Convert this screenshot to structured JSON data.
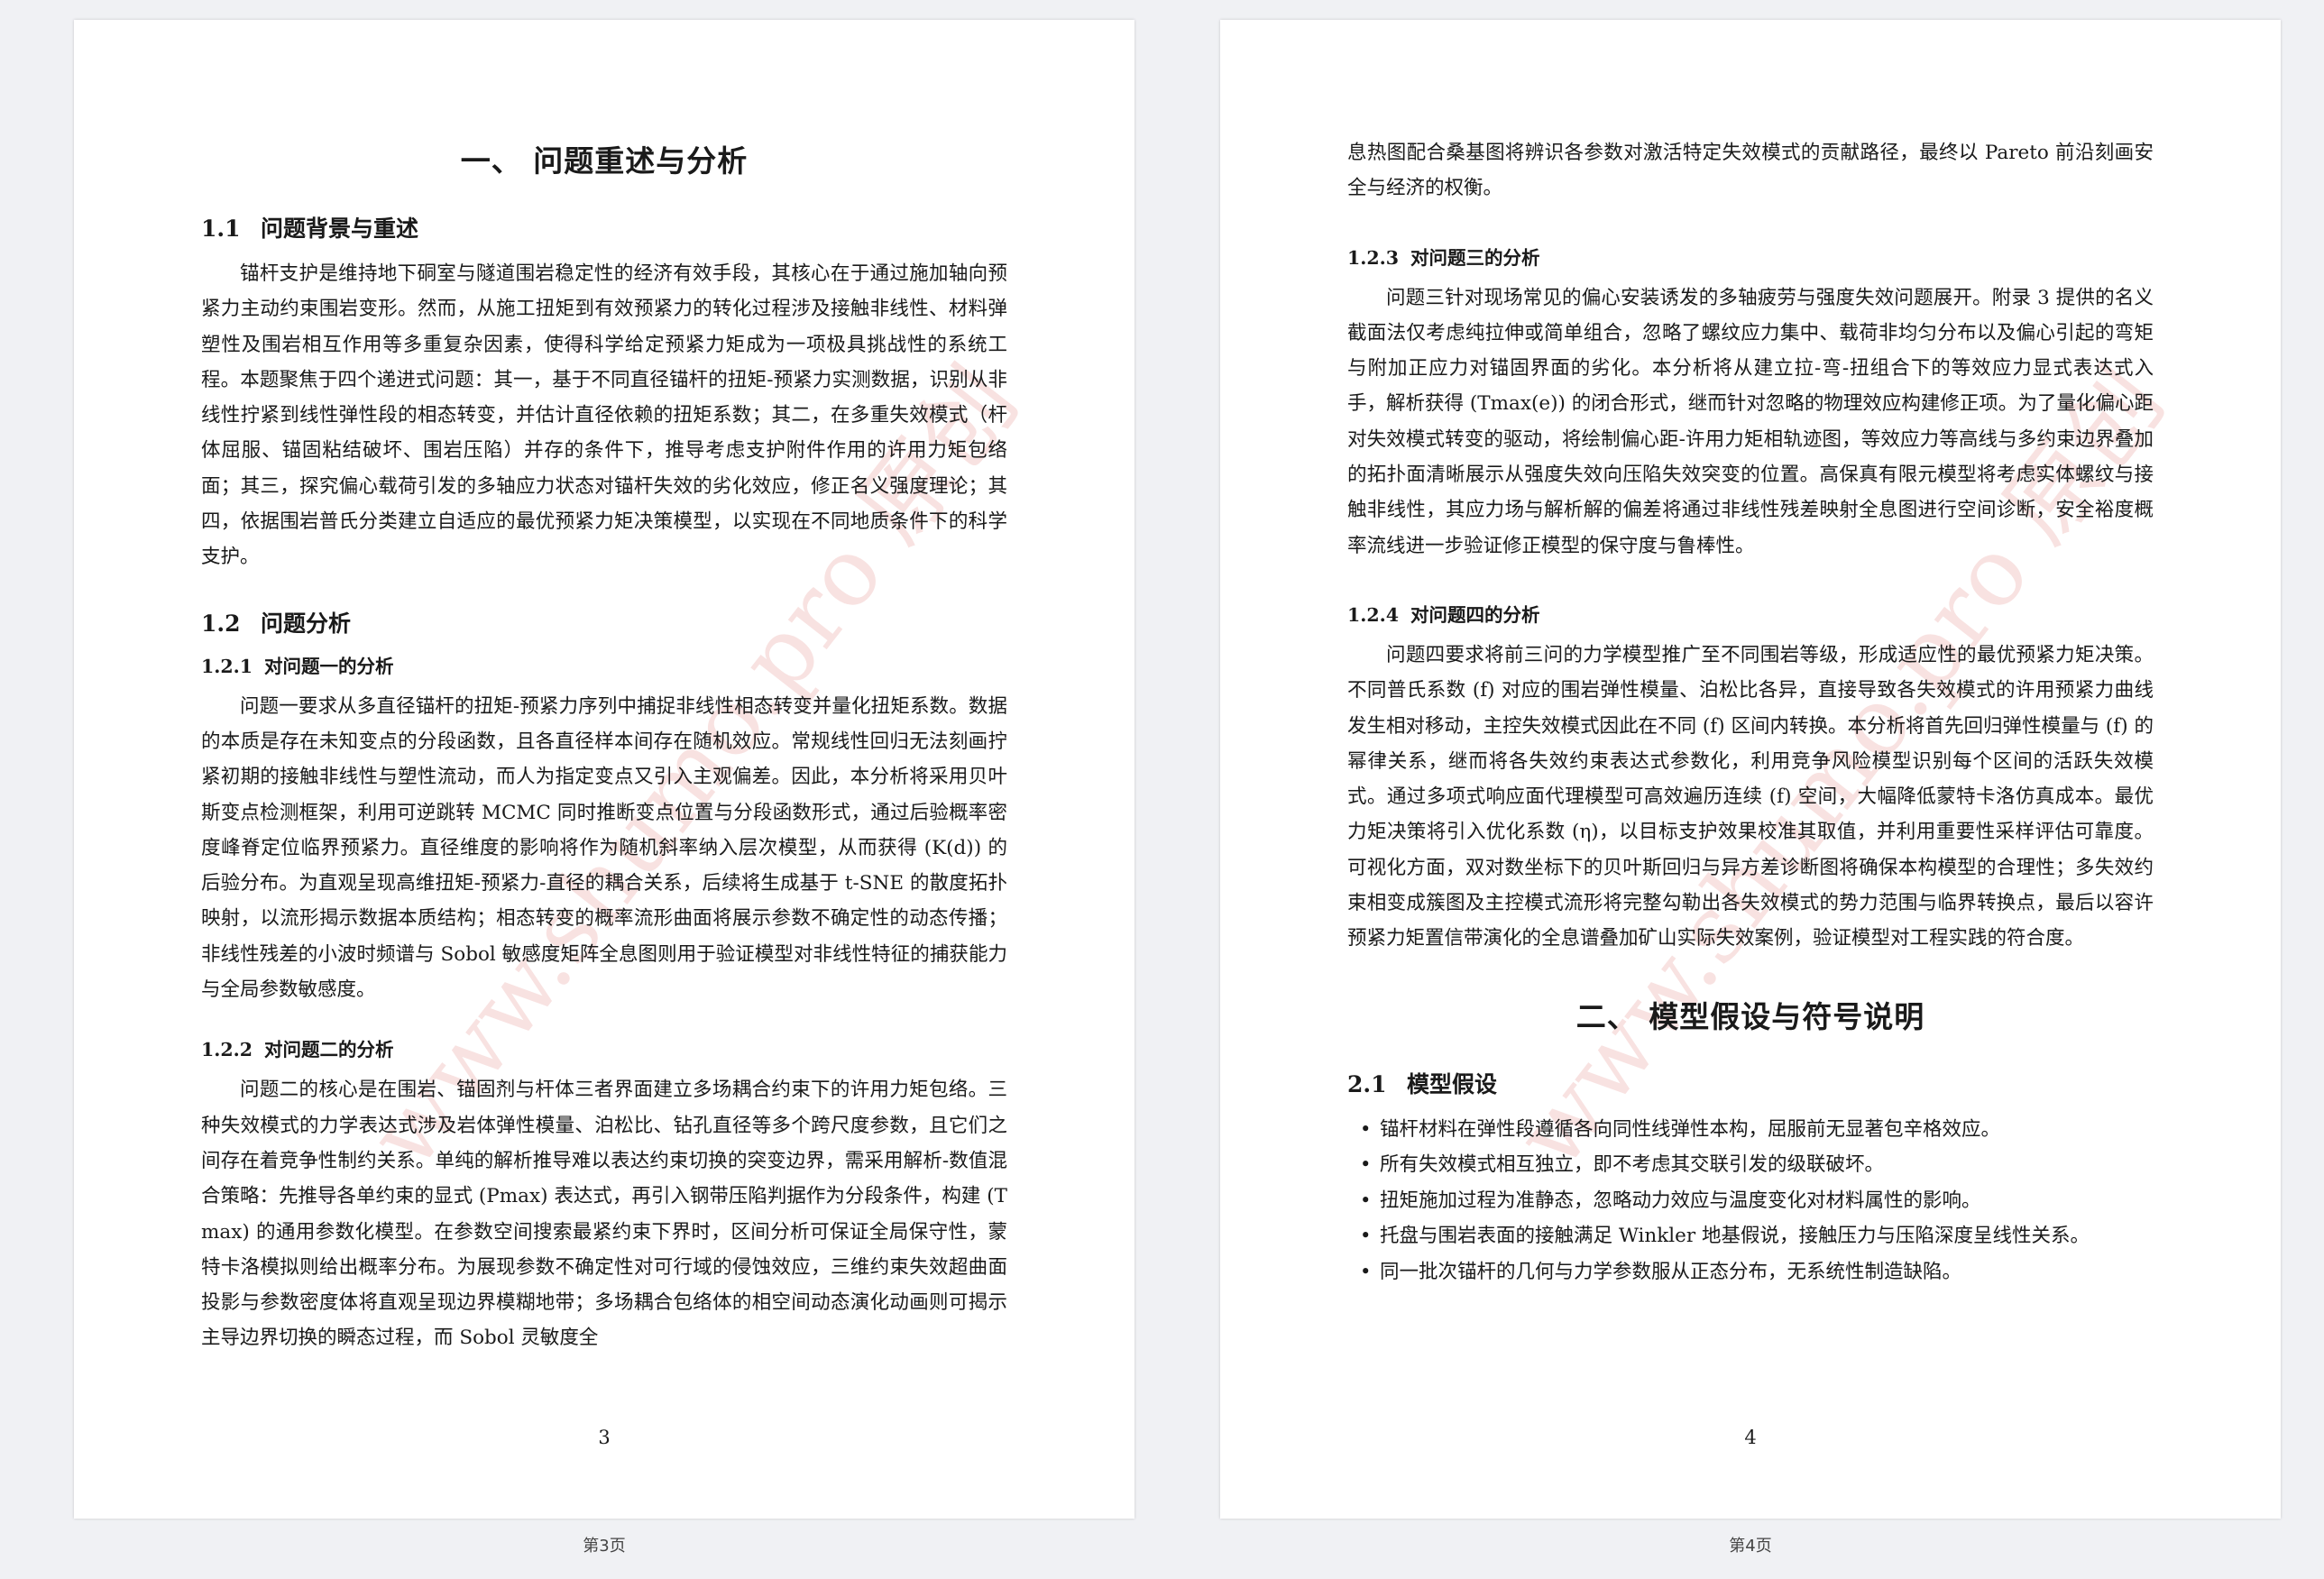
{
  "watermark": "www.shumo.pro 原创",
  "left_page": {
    "chapter_title": "一、 问题重述与分析",
    "s1_num": "1.1",
    "s1_title": "问题背景与重述",
    "s1_para": "锚杆支护是维持地下硐室与隧道围岩稳定性的经济有效手段，其核心在于通过施加轴向预紧力主动约束围岩变形。然而，从施工扭矩到有效预紧力的转化过程涉及接触非线性、材料弹塑性及围岩相互作用等多重复杂因素，使得科学给定预紧力矩成为一项极具挑战性的系统工程。本题聚焦于四个递进式问题：其一，基于不同直径锚杆的扭矩-预紧力实测数据，识别从非线性拧紧到线性弹性段的相态转变，并估计直径依赖的扭矩系数；其二，在多重失效模式（杆体屈服、锚固粘结破坏、围岩压陷）并存的条件下，推导考虑支护附件作用的许用力矩包络面；其三，探究偏心载荷引发的多轴应力状态对锚杆失效的劣化效应，修正名义强度理论；其四，依据围岩普氏分类建立自适应的最优预紧力矩决策模型，以实现在不同地质条件下的科学支护。",
    "s2_num": "1.2",
    "s2_title": "问题分析",
    "s21_num": "1.2.1",
    "s21_title": "对问题一的分析",
    "s21_para": "问题一要求从多直径锚杆的扭矩-预紧力序列中捕捉非线性相态转变并量化扭矩系数。数据的本质是存在未知变点的分段函数，且各直径样本间存在随机效应。常规线性回归无法刻画拧紧初期的接触非线性与塑性流动，而人为指定变点又引入主观偏差。因此，本分析将采用贝叶斯变点检测框架，利用可逆跳转 MCMC 同时推断变点位置与分段函数形式，通过后验概率密度峰脊定位临界预紧力。直径维度的影响将作为随机斜率纳入层次模型，从而获得 (K(d)) 的后验分布。为直观呈现高维扭矩-预紧力-直径的耦合关系，后续将生成基于 t-SNE 的散度拓扑映射，以流形揭示数据本质结构；相态转变的概率流形曲面将展示参数不确定性的动态传播；非线性残差的小波时频谱与 Sobol 敏感度矩阵全息图则用于验证模型对非线性特征的捕获能力与全局参数敏感度。",
    "s22_num": "1.2.2",
    "s22_title": "对问题二的分析",
    "s22_para": "问题二的核心是在围岩、锚固剂与杆体三者界面建立多场耦合约束下的许用力矩包络。三种失效模式的力学表达式涉及岩体弹性模量、泊松比、钻孔直径等多个跨尺度参数，且它们之间存在着竞争性制约关系。单纯的解析推导难以表达约束切换的突变边界，需采用解析-数值混合策略：先推导各单约束的显式 (Pmax) 表达式，再引入钢带压陷判据作为分段条件，构建 (Tmax) 的通用参数化模型。在参数空间搜索最紧约束下界时，区间分析可保证全局保守性，蒙特卡洛模拟则给出概率分布。为展现参数不确定性对可行域的侵蚀效应，三维约束失效超曲面投影与参数密度体将直观呈现边界模糊地带；多场耦合包络体的相空间动态演化动画则可揭示主导边界切换的瞬态过程，而 Sobol 灵敏度全",
    "page_number": "3"
  },
  "right_page": {
    "cont_para": "息热图配合桑基图将辨识各参数对激活特定失效模式的贡献路径，最终以 Pareto 前沿刻画安全与经济的权衡。",
    "s23_num": "1.2.3",
    "s23_title": "对问题三的分析",
    "s23_para": "问题三针对现场常见的偏心安装诱发的多轴疲劳与强度失效问题展开。附录 3 提供的名义截面法仅考虑纯拉伸或简单组合，忽略了螺纹应力集中、载荷非均匀分布以及偏心引起的弯矩与附加正应力对锚固界面的劣化。本分析将从建立拉-弯-扭组合下的等效应力显式表达式入手，解析获得 (Tmax(e)) 的闭合形式，继而针对忽略的物理效应构建修正项。为了量化偏心距对失效模式转变的驱动，将绘制偏心距-许用力矩相轨迹图，等效应力等高线与多约束边界叠加的拓扑面清晰展示从强度失效向压陷失效突变的位置。高保真有限元模型将考虑实体螺纹与接触非线性，其应力场与解析解的偏差将通过非线性残差映射全息图进行空间诊断，安全裕度概率流线进一步验证修正模型的保守度与鲁棒性。",
    "s24_num": "1.2.4",
    "s24_title": "对问题四的分析",
    "s24_para": "问题四要求将前三问的力学模型推广至不同围岩等级，形成适应性的最优预紧力矩决策。不同普氏系数 (f) 对应的围岩弹性模量、泊松比各异，直接导致各失效模式的许用预紧力曲线发生相对移动，主控失效模式因此在不同 (f) 区间内转换。本分析将首先回归弹性模量与 (f) 的幂律关系，继而将各失效约束表达式参数化，利用竞争风险模型识别每个区间的活跃失效模式。通过多项式响应面代理模型可高效遍历连续 (f) 空间，大幅降低蒙特卡洛仿真成本。最优力矩决策将引入优化系数 (η)，以目标支护效果校准其取值，并利用重要性采样评估可靠度。可视化方面，双对数坐标下的贝叶斯回归与异方差诊断图将确保本构模型的合理性；多失效约束相变成簇图及主控模式流形将完整勾勒出各失效模式的势力范围与临界转换点，最后以容许预紧力矩置信带演化的全息谱叠加矿山实际失效案例，验证模型对工程实践的符合度。",
    "chapter_title": "二、 模型假设与符号说明",
    "s3_num": "2.1",
    "s3_title": "模型假设",
    "assumptions": [
      "锚杆材料在弹性段遵循各向同性线弹性本构，屈服前无显著包辛格效应。",
      "所有失效模式相互独立，即不考虑其交联引发的级联破坏。",
      "扭矩施加过程为准静态，忽略动力效应与温度变化对材料属性的影响。",
      "托盘与围岩表面的接触满足 Winkler 地基假说，接触压力与压陷深度呈线性关系。",
      "同一批次锚杆的几何与力学参数服从正态分布，无系统性制造缺陷。"
    ],
    "page_number": "4"
  },
  "captions": {
    "left": "第3页",
    "right": "第4页"
  }
}
